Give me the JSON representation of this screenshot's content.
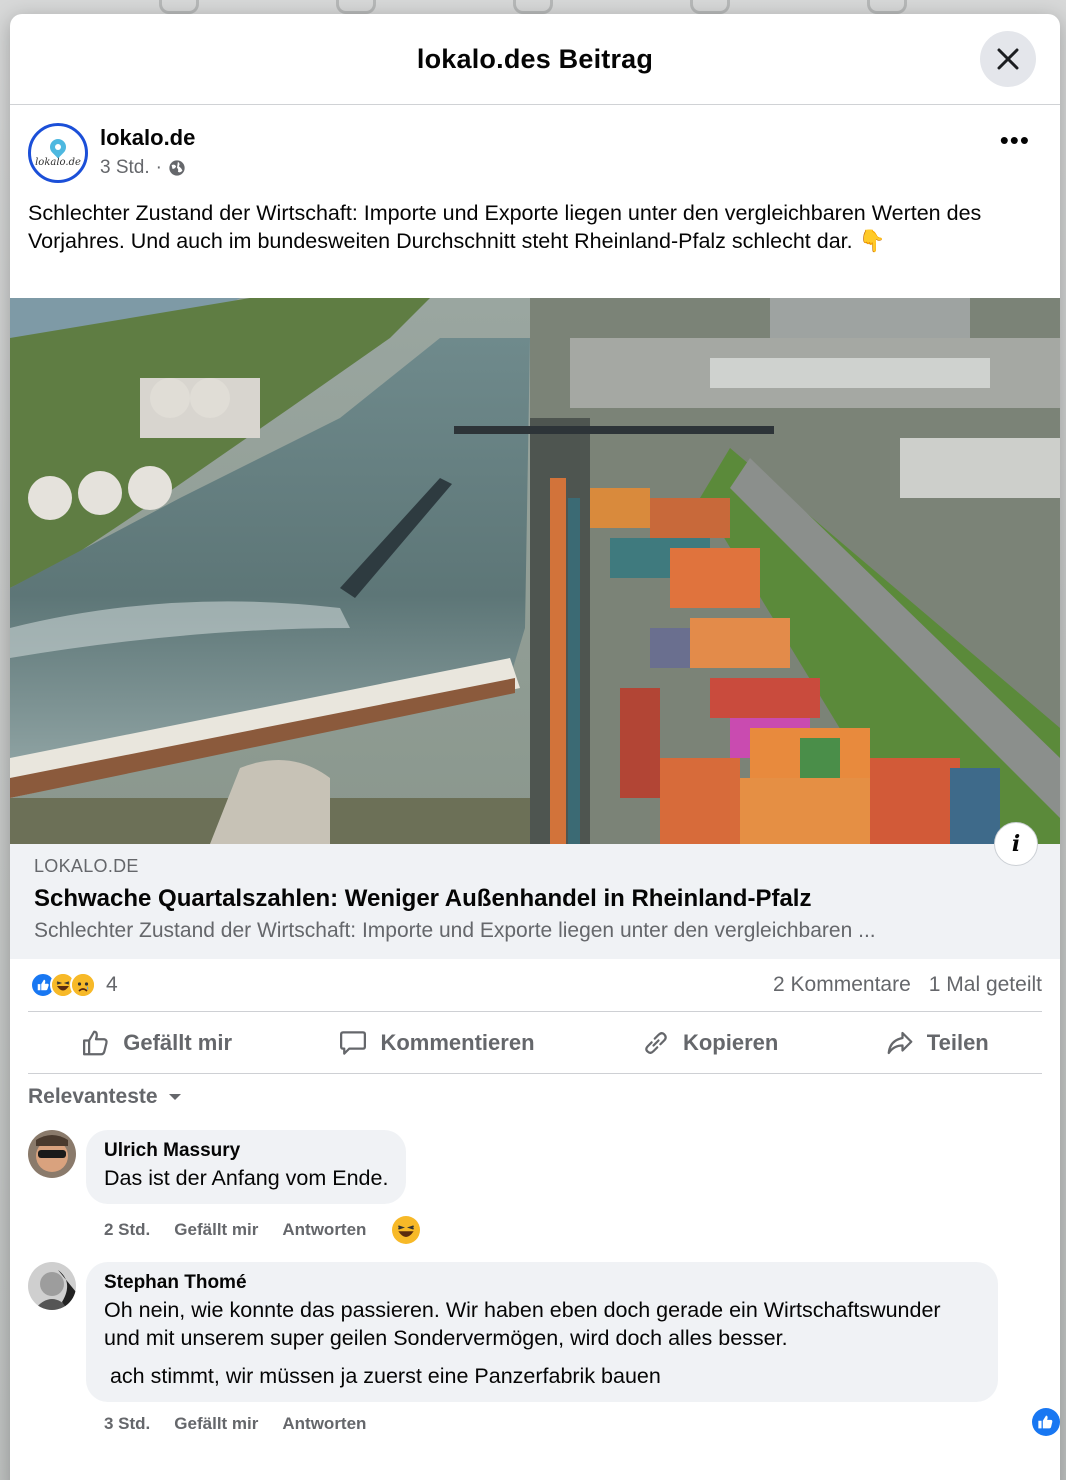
{
  "modal": {
    "title": "lokalo.des Beitrag"
  },
  "post": {
    "author": "lokalo.de",
    "avatar_text": "lokalo.de",
    "time": "3 Std.",
    "separator": "·",
    "privacy_icon": "globe-icon",
    "more_label": "•••",
    "text": "Schlechter Zustand der Wirtschaft: Importe und Exporte liegen unter den vergleichbaren Werten des Vorjahres. Und auch im bundesweiten Durchschnitt steht Rheinland-Pfalz schlecht dar. 👇"
  },
  "link_preview": {
    "domain": "LOKALO.DE",
    "title": "Schwache Quartalszahlen: Weniger Außenhandel in Rheinland-Pfalz",
    "description": "Schlechter Zustand der Wirtschaft: Importe und Exporte liegen unter den vergleichbaren ...",
    "info_label": "i"
  },
  "stats": {
    "reaction_icons": [
      "like-icon",
      "haha-icon",
      "sad-icon"
    ],
    "reaction_count": "4",
    "comments": "2 Kommentare",
    "shares": "1 Mal geteilt"
  },
  "actions": [
    {
      "label": "Gefällt mir",
      "icon": "thumbs-up-icon"
    },
    {
      "label": "Kommentieren",
      "icon": "comment-icon"
    },
    {
      "label": "Kopieren",
      "icon": "link-icon"
    },
    {
      "label": "Teilen",
      "icon": "share-icon"
    }
  ],
  "comments_sort": "Relevanteste",
  "comments": [
    {
      "author": "Ulrich Massury",
      "text": "Das ist der Anfang vom Ende.",
      "time": "2 Std.",
      "like": "Gefällt mir",
      "reply": "Antworten",
      "reaction": "haha-icon"
    },
    {
      "author": "Stephan Thomé",
      "text": "Oh nein, wie konnte das passieren. Wir haben eben doch gerade ein Wirtschaftswunder und mit unserem super geilen Sondervermögen, wird doch alles besser.",
      "text2": " ach stimmt, wir müssen ja zuerst eine Panzerfabrik bauen",
      "time": "3 Std.",
      "like": "Gefällt mir",
      "reply": "Antworten",
      "reaction": "like-icon"
    }
  ],
  "colors": {
    "accent": "#1877f2",
    "muted": "#65676b",
    "bubble": "#f0f2f5"
  }
}
